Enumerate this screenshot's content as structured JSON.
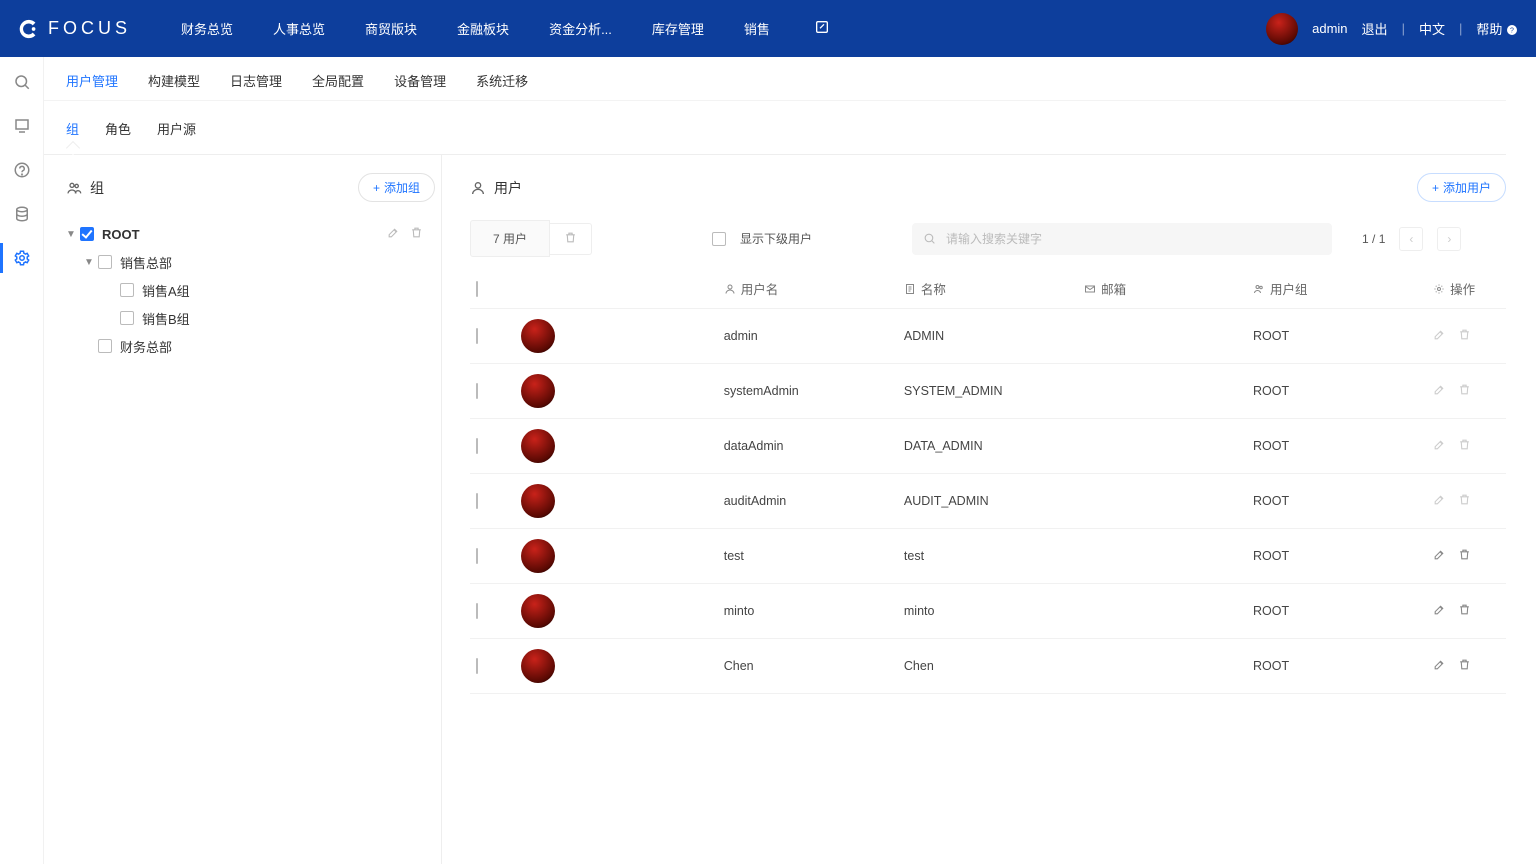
{
  "header": {
    "brand": "FOCUS",
    "nav": [
      "财务总览",
      "人事总览",
      "商贸版块",
      "金融板块",
      "资金分析...",
      "库存管理",
      "销售"
    ],
    "user": "admin",
    "logout": "退出",
    "lang": "中文",
    "help": "帮助"
  },
  "subnav": {
    "items": [
      "用户管理",
      "构建模型",
      "日志管理",
      "全局配置",
      "设备管理",
      "系统迁移"
    ],
    "activeIndex": 0
  },
  "subtabs": {
    "items": [
      "组",
      "角色",
      "用户源"
    ],
    "activeIndex": 0
  },
  "groups": {
    "title": "组",
    "addBtn": "添加组",
    "tree": [
      {
        "label": "ROOT",
        "level": 0,
        "checked": true,
        "caret": "open",
        "bold": true,
        "actions": true
      },
      {
        "label": "销售总部",
        "level": 1,
        "checked": false,
        "caret": "open"
      },
      {
        "label": "销售A组",
        "level": 2,
        "checked": false,
        "caret": ""
      },
      {
        "label": "销售B组",
        "level": 2,
        "checked": false,
        "caret": ""
      },
      {
        "label": "财务总部",
        "level": 1,
        "checked": false,
        "caret": ""
      }
    ]
  },
  "users": {
    "title": "用户",
    "addBtn": "添加用户",
    "countLabel": "7 用户",
    "showSubLabel": "显示下级用户",
    "searchPlaceholder": "请输入搜索关键字",
    "page": "1 / 1",
    "columns": {
      "username": "用户名",
      "name": "名称",
      "email": "邮箱",
      "group": "用户组",
      "op": "操作"
    },
    "rows": [
      {
        "username": "admin",
        "name": "ADMIN",
        "email": "",
        "group": "ROOT",
        "editable": false
      },
      {
        "username": "systemAdmin",
        "name": "SYSTEM_ADMIN",
        "email": "",
        "group": "ROOT",
        "editable": false
      },
      {
        "username": "dataAdmin",
        "name": "DATA_ADMIN",
        "email": "",
        "group": "ROOT",
        "editable": false
      },
      {
        "username": "auditAdmin",
        "name": "AUDIT_ADMIN",
        "email": "",
        "group": "ROOT",
        "editable": false
      },
      {
        "username": "test",
        "name": "test",
        "email": "",
        "group": "ROOT",
        "editable": true
      },
      {
        "username": "minto",
        "name": "minto",
        "email": "",
        "group": "ROOT",
        "editable": true
      },
      {
        "username": "Chen",
        "name": "Chen",
        "email": "",
        "group": "ROOT",
        "editable": true
      }
    ]
  }
}
